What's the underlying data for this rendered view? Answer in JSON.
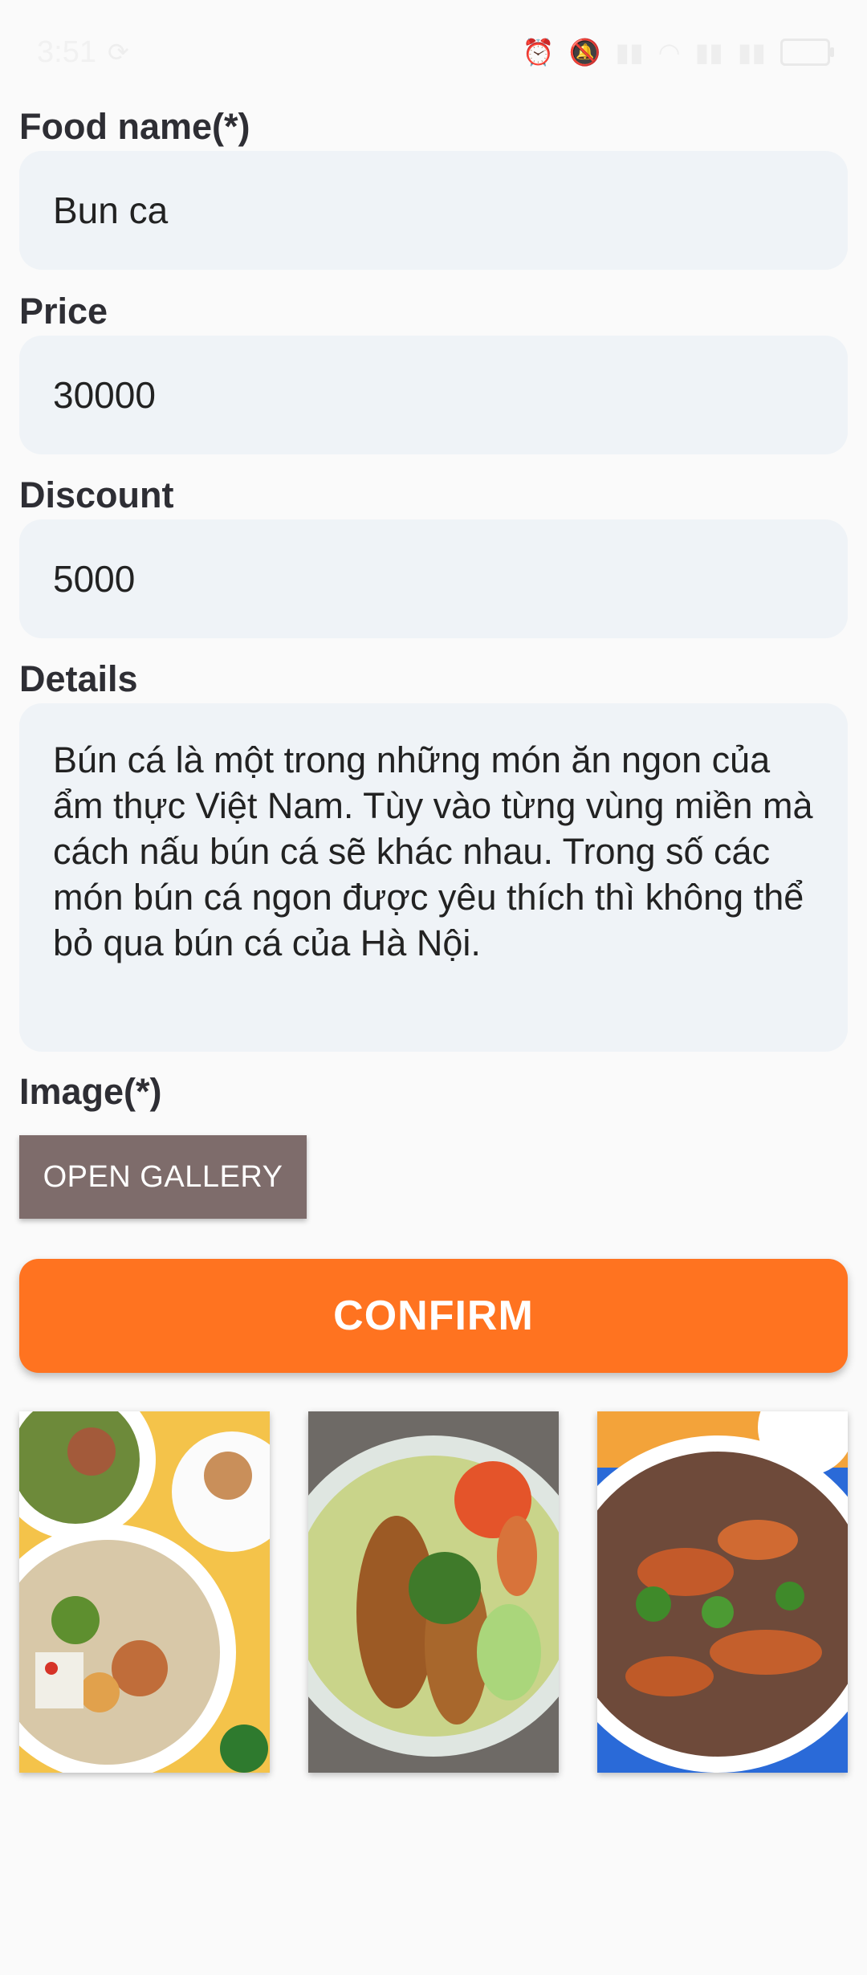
{
  "status_bar": {
    "time": "3:51",
    "left_icon": "sync-icon",
    "right_icons": [
      "alarm-icon",
      "mute-icon",
      "signal-icon",
      "wifi-icon",
      "signal-icon",
      "signal-icon",
      "battery-icon"
    ]
  },
  "form": {
    "food_name_label": "Food name(*)",
    "food_name_value": "Bun ca",
    "price_label": "Price",
    "price_value": "30000",
    "discount_label": "Discount",
    "discount_value": "5000",
    "details_label": "Details",
    "details_value": "Bún cá là một trong những món ăn ngon của ẩm thực Việt Nam. Tùy vào từng vùng miền mà cách nấu bún cá sẽ khác nhau. Trong số các món bún cá ngon được yêu thích thì không thể bỏ qua bún cá của Hà Nội.",
    "image_label": "Image(*)",
    "open_gallery_label": "OPEN GALLERY",
    "confirm_label": "CONFIRM"
  },
  "images": [
    {
      "name": "food-photo-1"
    },
    {
      "name": "food-photo-2"
    },
    {
      "name": "food-photo-3"
    }
  ],
  "colors": {
    "accent": "#ff7320",
    "gallery_button": "#7e6c6b",
    "input_bg": "#eff3f7"
  }
}
